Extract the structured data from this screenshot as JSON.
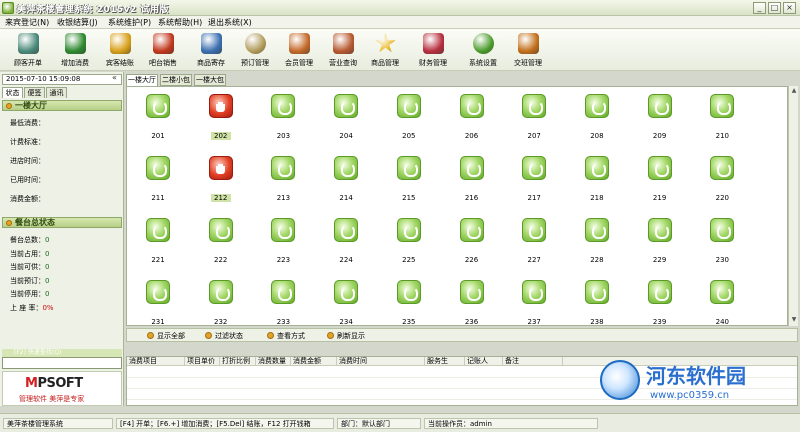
{
  "window": {
    "title": "美萍茶楼管理系统 2015v2 试用版",
    "min": "_",
    "max": "□",
    "close": "×"
  },
  "menu": [
    "来宾登记(N)",
    "收银结算(J)",
    "系统维护(P)",
    "系统帮助(H)",
    "退出系统(X)"
  ],
  "toolbar": [
    {
      "label": "顾客开单",
      "icon": "teapot-icon",
      "color": "#4a8a7a"
    },
    {
      "label": "增加消费",
      "icon": "add-consumption-icon",
      "color": "#2f8a2f"
    },
    {
      "label": "宾客结账",
      "icon": "checkout-arrow-icon",
      "color": "#d8a01a"
    },
    {
      "label": "吧台销售",
      "icon": "bar-sales-icon",
      "color": "#c2381e"
    },
    {
      "label": "商品寄存",
      "icon": "storage-basket-icon",
      "color": "#3b6fb0"
    },
    {
      "label": "预订管理",
      "icon": "clock-icon",
      "color": "#b09a5a"
    },
    {
      "label": "会员管理",
      "icon": "members-icon",
      "color": "#c46a2a"
    },
    {
      "label": "营业查询",
      "icon": "query-hand-icon",
      "color": "#b85a30"
    },
    {
      "label": "商品管理",
      "icon": "star-icon",
      "color": "#e8b51a"
    },
    {
      "label": "财务管理",
      "icon": "finance-calculator-icon",
      "color": "#b83040"
    },
    {
      "label": "系统设置",
      "icon": "gear-icon",
      "color": "#4a9a2a"
    },
    {
      "label": "交班管理",
      "icon": "exit-door-icon",
      "color": "#c2701a"
    }
  ],
  "left": {
    "datetime": "2015-07-10 15:09:08",
    "collapse": "«",
    "tabs": [
      "状态",
      "便签",
      "通讯"
    ],
    "room_section": "一楼大厅",
    "room_info": [
      {
        "label": "最低消费：",
        "value": ""
      },
      {
        "label": "计费标准：",
        "value": ""
      },
      {
        "label": "进店时间：",
        "value": ""
      },
      {
        "label": "已用时间：",
        "value": ""
      },
      {
        "label": "消费金额：",
        "value": ""
      }
    ],
    "status_section": "餐台总状态",
    "status_info": [
      {
        "label": "餐台总数：",
        "value": "0"
      },
      {
        "label": "当前占用：",
        "value": "0"
      },
      {
        "label": "当前可供：",
        "value": "0"
      },
      {
        "label": "当前预订：",
        "value": "0"
      },
      {
        "label": "当前停用：",
        "value": "0"
      },
      {
        "label": "上 座 率：",
        "value": "0%"
      }
    ],
    "quick_search": "[F2] 快速查找(Q)",
    "logo": {
      "a": "M",
      "b": "PSOFT",
      "slogan": "管理软件 美萍是专家"
    }
  },
  "room_tabs": [
    "一楼大厅",
    "二楼小包",
    "一楼大包"
  ],
  "rooms": [
    {
      "n": "201",
      "s": "free"
    },
    {
      "n": "202",
      "s": "busy",
      "sel": true
    },
    {
      "n": "203",
      "s": "free"
    },
    {
      "n": "204",
      "s": "free"
    },
    {
      "n": "205",
      "s": "free"
    },
    {
      "n": "206",
      "s": "free"
    },
    {
      "n": "207",
      "s": "free"
    },
    {
      "n": "208",
      "s": "free"
    },
    {
      "n": "209",
      "s": "free"
    },
    {
      "n": "210",
      "s": "free"
    },
    {
      "n": "211",
      "s": "free"
    },
    {
      "n": "212",
      "s": "busy",
      "sel": true
    },
    {
      "n": "213",
      "s": "free"
    },
    {
      "n": "214",
      "s": "free"
    },
    {
      "n": "215",
      "s": "free"
    },
    {
      "n": "216",
      "s": "free"
    },
    {
      "n": "217",
      "s": "free"
    },
    {
      "n": "218",
      "s": "free"
    },
    {
      "n": "219",
      "s": "free"
    },
    {
      "n": "220",
      "s": "free"
    },
    {
      "n": "221",
      "s": "free"
    },
    {
      "n": "222",
      "s": "free"
    },
    {
      "n": "223",
      "s": "free"
    },
    {
      "n": "224",
      "s": "free"
    },
    {
      "n": "225",
      "s": "free"
    },
    {
      "n": "226",
      "s": "free"
    },
    {
      "n": "227",
      "s": "free"
    },
    {
      "n": "228",
      "s": "free"
    },
    {
      "n": "229",
      "s": "free"
    },
    {
      "n": "230",
      "s": "free"
    },
    {
      "n": "231",
      "s": "free"
    },
    {
      "n": "232",
      "s": "free"
    },
    {
      "n": "233",
      "s": "free"
    },
    {
      "n": "234",
      "s": "free"
    },
    {
      "n": "235",
      "s": "free"
    },
    {
      "n": "236",
      "s": "free"
    },
    {
      "n": "237",
      "s": "free"
    },
    {
      "n": "238",
      "s": "free"
    },
    {
      "n": "239",
      "s": "free"
    },
    {
      "n": "240",
      "s": "free"
    }
  ],
  "grid_bar": [
    "显示全部",
    "过滤状态",
    "查看方式",
    "刷新显示"
  ],
  "detail_columns": [
    "消费项目",
    "项目单价",
    "打折比例",
    "消费数量",
    "消费金额",
    "消费时间",
    "服务生",
    "记账人",
    "备注"
  ],
  "status": {
    "app": "美萍茶楼管理系统",
    "keys": "[F4] 开单；[F6.+] 增加消费；[F5.Del] 结账，F12 打开钱箱",
    "dept": "部门：默认部门",
    "operator": "当前操作员：admin"
  },
  "watermark": {
    "title": "河东软件园",
    "url": "www.pc0359.cn"
  }
}
